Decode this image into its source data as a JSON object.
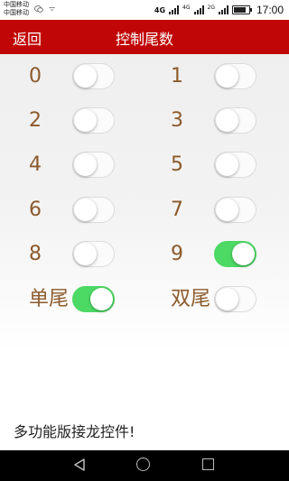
{
  "status_bar": {
    "carrier_1": "中国移动",
    "carrier_2": "中国移动",
    "network_1": "4G",
    "network_2": "4G",
    "network_3": "2G",
    "time": "17:00"
  },
  "header": {
    "back_label": "返回",
    "title": "控制尾数",
    "color": "#c10606"
  },
  "tails": [
    {
      "label": "0",
      "on": false
    },
    {
      "label": "1",
      "on": false
    },
    {
      "label": "2",
      "on": false
    },
    {
      "label": "3",
      "on": false
    },
    {
      "label": "4",
      "on": false
    },
    {
      "label": "5",
      "on": false
    },
    {
      "label": "6",
      "on": false
    },
    {
      "label": "7",
      "on": false
    },
    {
      "label": "8",
      "on": false
    },
    {
      "label": "9",
      "on": true
    }
  ],
  "parity": {
    "single": {
      "label": "单尾",
      "on": true
    },
    "double": {
      "label": "双尾",
      "on": false
    }
  },
  "footer": {
    "text": "多功能版接龙控件!"
  },
  "colors": {
    "label": "#8b5a2b",
    "switch_on": "#4cd964"
  }
}
